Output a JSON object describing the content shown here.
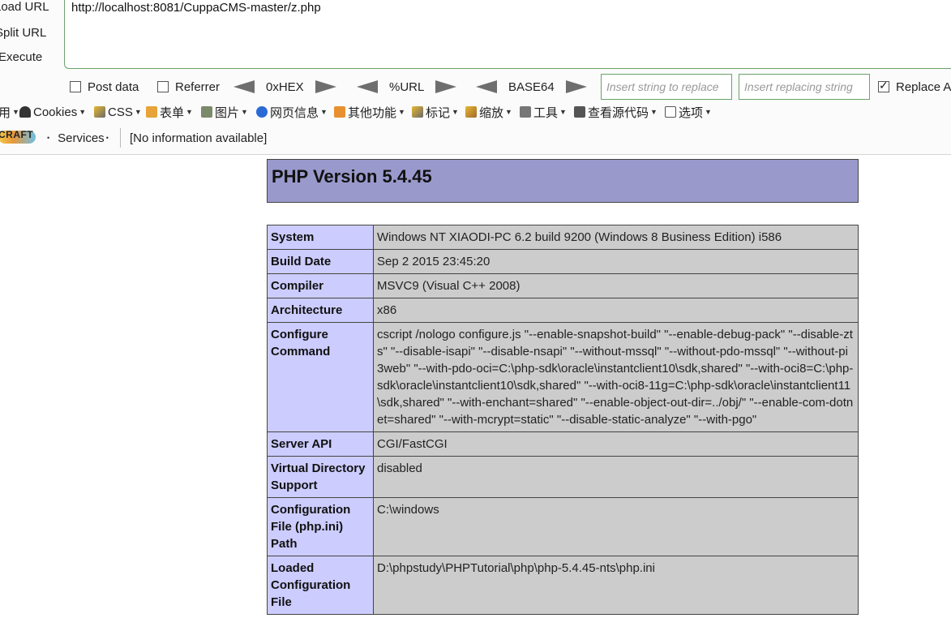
{
  "hackbar": {
    "load_url": "Load URL",
    "split_url": "Split URL",
    "execute": "Execute",
    "url": "http://localhost:8081/CuppaCMS-master/z.php",
    "post_data": "Post data",
    "referrer": "Referrer",
    "hex": "0xHEX",
    "urlenc": "%URL",
    "base64": "BASE64",
    "insert_placeholder": "Insert string to replace",
    "replacing_placeholder": "Insert replacing string",
    "replace_all": "Replace All"
  },
  "menubar": {
    "items": [
      "Cookies",
      "CSS",
      "表单",
      "图片",
      "网页信息",
      "其他功能",
      "标记",
      "缩放",
      "工具",
      "查看源代码",
      "选项"
    ]
  },
  "statusbar": {
    "logo": "CRAFT",
    "services": "Services",
    "info": "[No information available]"
  },
  "phpinfo": {
    "title": "PHP Version 5.4.45",
    "rows": [
      {
        "k": "System",
        "v": "Windows NT XIAODI-PC 6.2 build 9200 (Windows 8 Business Edition) i586"
      },
      {
        "k": "Build Date",
        "v": "Sep 2 2015 23:45:20"
      },
      {
        "k": "Compiler",
        "v": "MSVC9 (Visual C++ 2008)"
      },
      {
        "k": "Architecture",
        "v": "x86"
      },
      {
        "k": "Configure Command",
        "v": "cscript /nologo configure.js \"--enable-snapshot-build\" \"--enable-debug-pack\" \"--disable-zts\" \"--disable-isapi\" \"--disable-nsapi\" \"--without-mssql\" \"--without-pdo-mssql\" \"--without-pi3web\" \"--with-pdo-oci=C:\\php-sdk\\oracle\\instantclient10\\sdk,shared\" \"--with-oci8=C:\\php-sdk\\oracle\\instantclient10\\sdk,shared\" \"--with-oci8-11g=C:\\php-sdk\\oracle\\instantclient11\\sdk,shared\" \"--with-enchant=shared\" \"--enable-object-out-dir=../obj/\" \"--enable-com-dotnet=shared\" \"--with-mcrypt=static\" \"--disable-static-analyze\" \"--with-pgo\""
      },
      {
        "k": "Server API",
        "v": "CGI/FastCGI"
      },
      {
        "k": "Virtual Directory Support",
        "v": "disabled"
      },
      {
        "k": "Configuration File (php.ini) Path",
        "v": "C:\\windows"
      },
      {
        "k": "Loaded Configuration File",
        "v": "D:\\phpstudy\\PHPTutorial\\php\\php-5.4.45-nts\\php.ini"
      }
    ]
  }
}
